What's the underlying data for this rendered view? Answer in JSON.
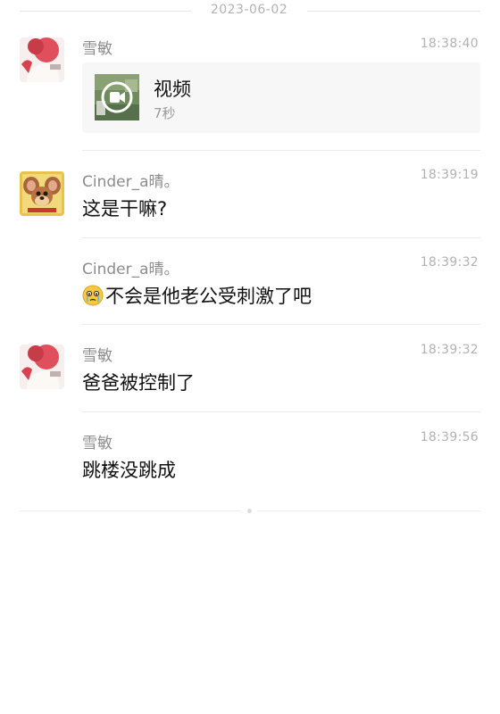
{
  "date_separator": "2023-06-02",
  "messages": [
    {
      "sender": "雪敏",
      "time": "18:38:40",
      "video": {
        "title": "视频",
        "duration": "7秒"
      }
    },
    {
      "sender": "Cinder_a晴。",
      "time": "18:39:19",
      "text": "这是干嘛?"
    },
    {
      "sender": "Cinder_a晴。",
      "time": "18:39:32",
      "text": "不会是他老公受刺激了吧",
      "emoji": "crying-face"
    },
    {
      "sender": "雪敏",
      "time": "18:39:32",
      "text": "爸爸被控制了"
    },
    {
      "sender": "雪敏",
      "time": "18:39:56",
      "text": "跳楼没跳成"
    }
  ]
}
